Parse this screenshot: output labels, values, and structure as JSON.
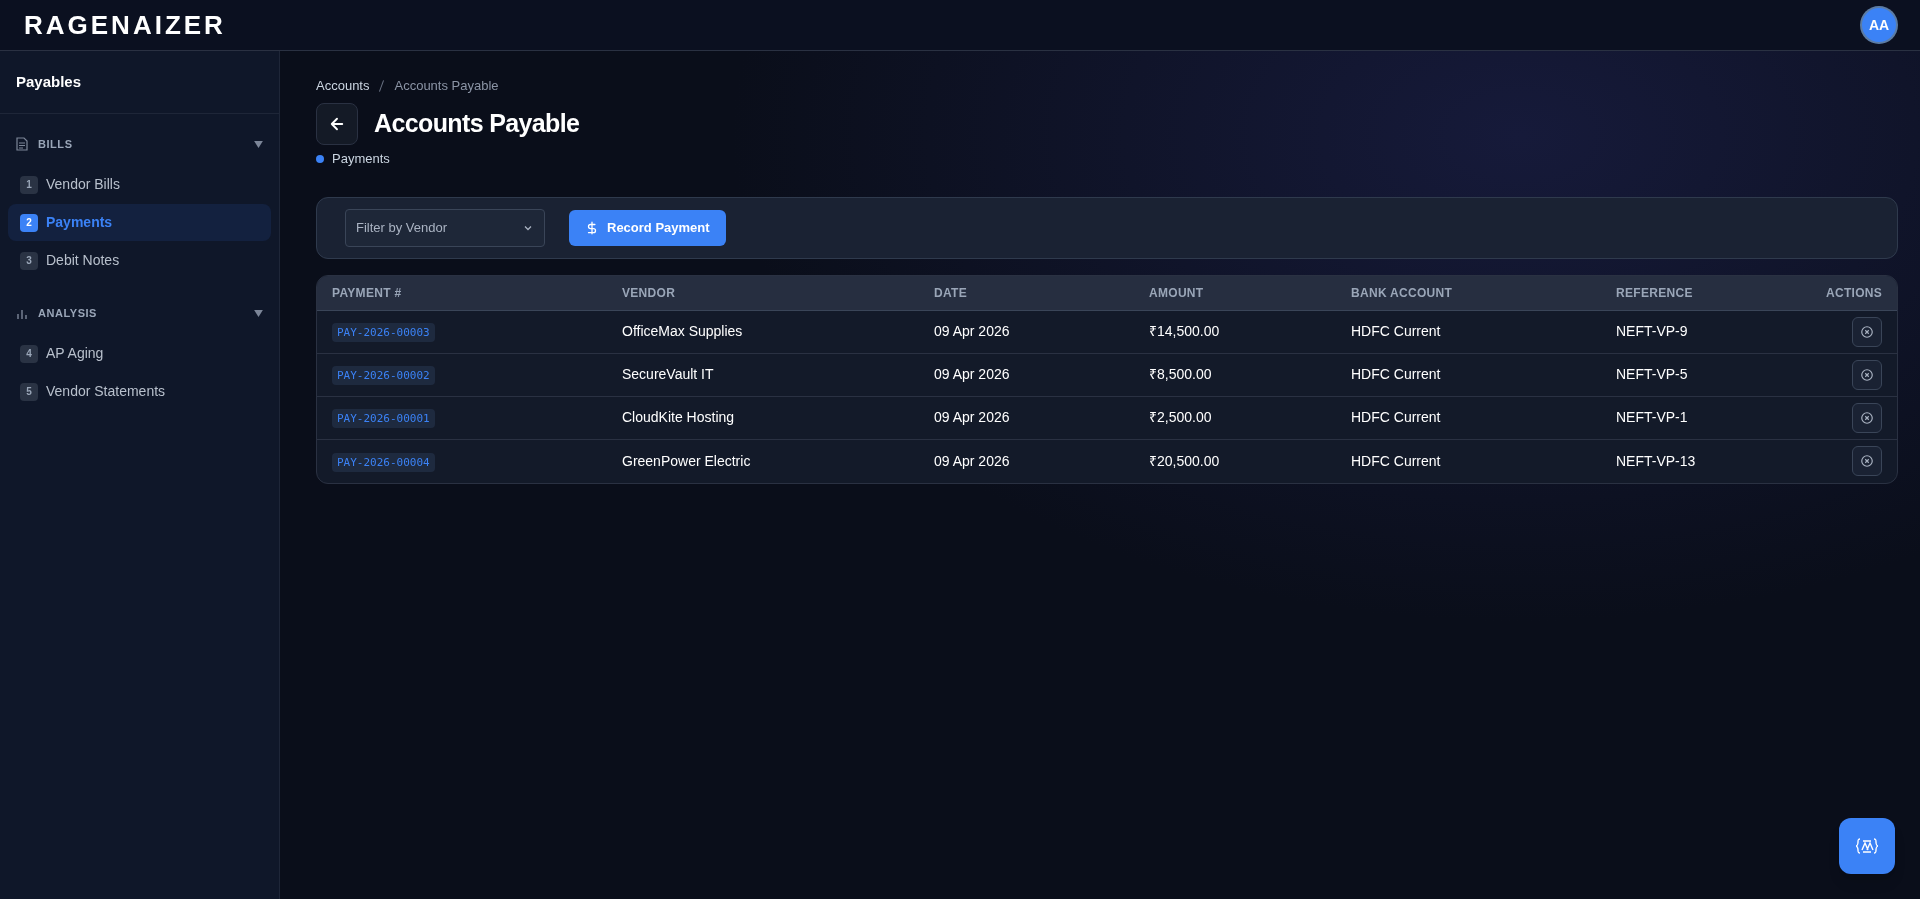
{
  "header": {
    "logo": "RAGENAIZER",
    "avatar": "AA"
  },
  "sidebar": {
    "title": "Payables",
    "groups": [
      {
        "label": "BILLS",
        "kind": "document",
        "expanded": true,
        "items": [
          {
            "number": "1",
            "label": "Vendor Bills",
            "selected": false
          },
          {
            "number": "2",
            "label": "Payments",
            "selected": true
          },
          {
            "number": "3",
            "label": "Debit Notes",
            "selected": false
          }
        ]
      },
      {
        "label": "ANALYSIS",
        "kind": "chart",
        "expanded": true,
        "items": [
          {
            "number": "4",
            "label": "AP Aging",
            "selected": false
          },
          {
            "number": "5",
            "label": "Vendor Statements",
            "selected": false
          }
        ]
      }
    ]
  },
  "breadcrumb": [
    "Accounts",
    "Accounts Payable"
  ],
  "page": {
    "title": "Accounts Payable",
    "subtitle": "Payments"
  },
  "toolbar": {
    "filter": {
      "placeholder": "Filter by Vendor"
    },
    "button": "Record Payment"
  },
  "table": {
    "columns": [
      "PAYMENT #",
      "VENDOR",
      "DATE",
      "AMOUNT",
      "BANK ACCOUNT",
      "REFERENCE",
      "ACTIONS"
    ],
    "rows": [
      {
        "payment": "PAY-2026-00003",
        "vendor": "OfficeMax Supplies",
        "date": "09 Apr 2026",
        "amount": "₹14,500.00",
        "bank": "HDFC Current",
        "reference": "NEFT-VP-9"
      },
      {
        "payment": "PAY-2026-00002",
        "vendor": "SecureVault IT",
        "date": "09 Apr 2026",
        "amount": "₹8,500.00",
        "bank": "HDFC Current",
        "reference": "NEFT-VP-5"
      },
      {
        "payment": "PAY-2026-00001",
        "vendor": "CloudKite Hosting",
        "date": "09 Apr 2026",
        "amount": "₹2,500.00",
        "bank": "HDFC Current",
        "reference": "NEFT-VP-1"
      },
      {
        "payment": "PAY-2026-00004",
        "vendor": "GreenPower Electric",
        "date": "09 Apr 2026",
        "amount": "₹20,500.00",
        "bank": "HDFC Current",
        "reference": "NEFT-VP-13"
      }
    ]
  }
}
